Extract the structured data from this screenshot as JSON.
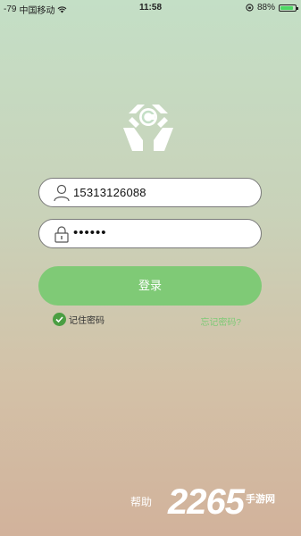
{
  "status_bar": {
    "signal": "-79",
    "carrier": "中国移动",
    "time": "11:58",
    "battery_percent": "88%",
    "battery_level": 0.88
  },
  "logo": {
    "icon": "bank-logo-icon"
  },
  "form": {
    "phone_value": "15313126088",
    "password_value": "••••••",
    "user_icon": "user-icon",
    "lock_icon": "lock-icon"
  },
  "login_button": {
    "label": "登录"
  },
  "remember": {
    "label": "记住密码",
    "checked": true
  },
  "forgot_link": {
    "label": "忘记密码?"
  },
  "help_link": {
    "label": "帮助"
  },
  "watermark": {
    "number": "2265",
    "text": "手游网"
  },
  "colors": {
    "accent": "#7fca76",
    "checkbox": "#4a9e42",
    "bg_top": "#c4dfc6",
    "bg_bottom": "#d2b29b"
  }
}
